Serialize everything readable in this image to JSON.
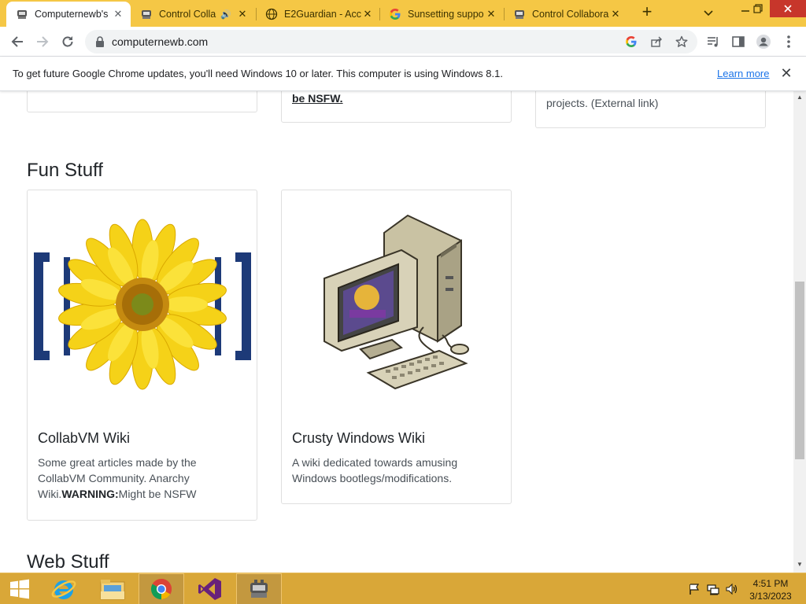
{
  "tabs": [
    {
      "title": "Computernewb's",
      "active": true
    },
    {
      "title": "Control Colla",
      "active": false
    },
    {
      "title": "E2Guardian - Acc",
      "active": false
    },
    {
      "title": "Sunsetting suppo",
      "active": false
    },
    {
      "title": "Control Collabora",
      "active": false
    }
  ],
  "tab_icons": [
    "collabvm-icon",
    "collabvm-icon",
    "globe-icon",
    "google-icon",
    "collabvm-icon"
  ],
  "toolbar": {
    "url": "computernewb.com"
  },
  "infobar": {
    "message": "To get future Google Chrome updates, you'll need Windows 10 or later. This computer is using Windows 8.1.",
    "learn_more": "Learn more"
  },
  "page": {
    "top_cards": [
      {
        "text_tail": "be NSFW."
      },
      {
        "text_tail": "projects. (External link)"
      }
    ],
    "fun_heading": "Fun Stuff",
    "fun_cards": [
      {
        "title": "CollabVM Wiki",
        "desc": "Some great articles made by the CollabVM Community. Anarchy Wiki.",
        "warning_label": "WARNING:",
        "warning_text": "Might be NSFW"
      },
      {
        "title": "Crusty Windows Wiki",
        "desc": "A wiki dedicated towards amusing Windows bootlegs/modifications."
      }
    ],
    "web_heading": "Web Stuff"
  },
  "taskbar": {
    "time": "4:51 PM",
    "date": "3/13/2023"
  },
  "colors": {
    "chrome_frame": "#f5c745",
    "taskbar": "#d9a738",
    "link_blue": "#1a73e8"
  }
}
